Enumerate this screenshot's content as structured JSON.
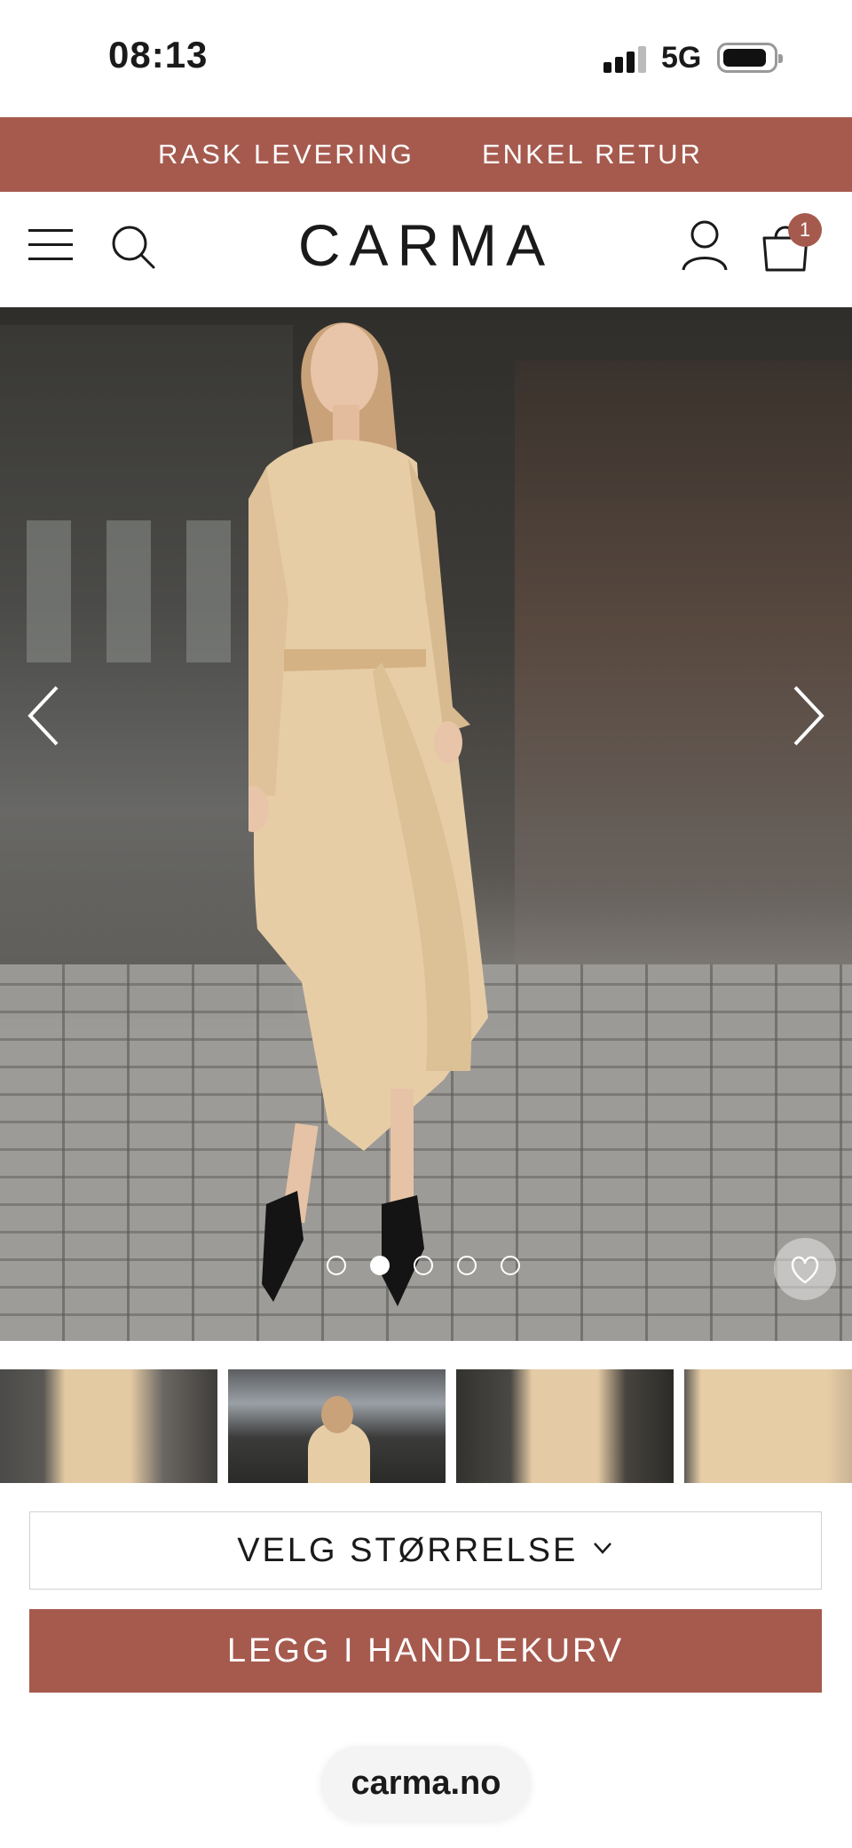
{
  "status_bar": {
    "time": "08:13",
    "network": "5G",
    "icons": [
      "signal-icon",
      "battery-icon"
    ]
  },
  "promo": {
    "items": [
      "RASK LEVERING",
      "ENKEL RETUR"
    ],
    "color": "#a65a4e"
  },
  "header": {
    "logo": "CARMA",
    "icons": [
      "menu-icon",
      "search-icon",
      "user-icon",
      "shopping-bag-icon"
    ],
    "cart_count": "1"
  },
  "gallery": {
    "image_count": 5,
    "active_index": 1,
    "icons": [
      "chevron-left-icon",
      "chevron-right-icon",
      "heart-icon"
    ],
    "thumbnail_count": 4
  },
  "product": {
    "size_select_label": "VELG STØRRELSE",
    "add_to_cart_label": "LEGG I HANDLEKURV"
  },
  "browser": {
    "url": "carma.no"
  }
}
